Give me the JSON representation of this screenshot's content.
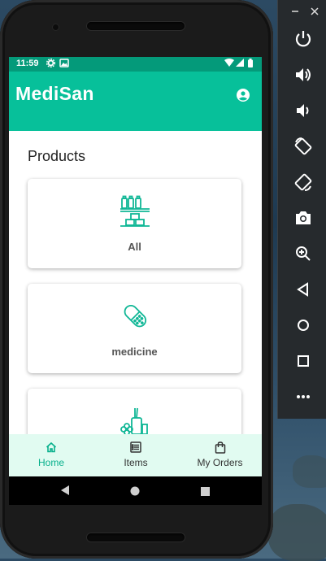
{
  "status_bar": {
    "time": "11:59"
  },
  "app_bar": {
    "title": "MediSan",
    "account_icon": "account-circle-icon"
  },
  "products": {
    "heading": "Products",
    "items": [
      {
        "label": "All",
        "icon": "shelf-bottles-icon"
      },
      {
        "label": "medicine",
        "icon": "capsule-pill-icon"
      },
      {
        "label": "",
        "icon": "flower-bottle-icon"
      }
    ]
  },
  "bottom_nav": {
    "items": [
      {
        "label": "Home",
        "icon": "home-icon",
        "active": true
      },
      {
        "label": "Items",
        "icon": "list-icon",
        "active": false
      },
      {
        "label": "My Orders",
        "icon": "shopping-bag-icon",
        "active": false
      }
    ]
  },
  "colors": {
    "primary": "#07c09a",
    "status_bar": "#049a7a",
    "nav_bg": "#e1fbf1",
    "accent": "#07b08c"
  },
  "emulator_toolbar": {
    "window_controls": [
      "minimize-icon",
      "close-icon"
    ],
    "buttons": [
      "power-icon",
      "volume-up-icon",
      "volume-down-icon",
      "rotate-left-icon",
      "rotate-right-icon",
      "camera-icon",
      "zoom-icon",
      "back-icon",
      "home-circle-icon",
      "overview-icon",
      "more-icon"
    ]
  }
}
